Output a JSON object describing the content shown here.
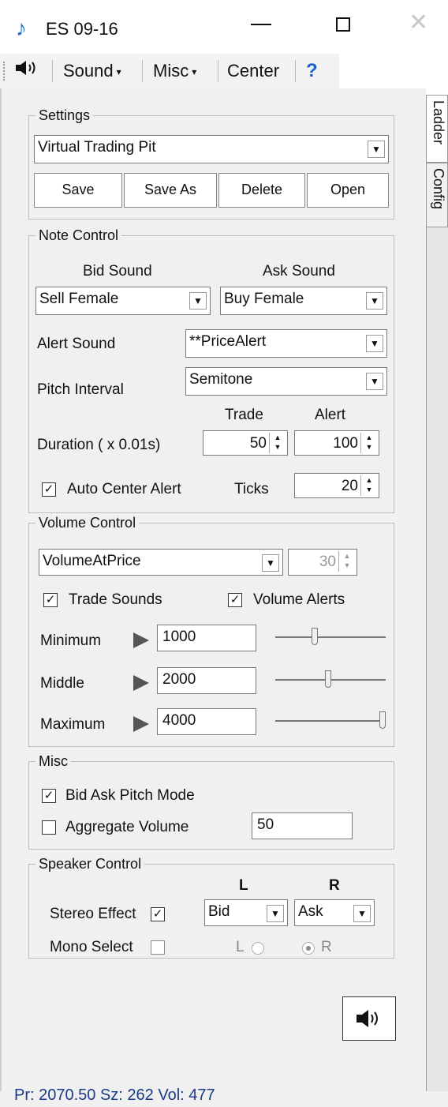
{
  "window": {
    "title": "ES 09-16"
  },
  "toolbar": {
    "sound": "Sound",
    "misc": "Misc",
    "center": "Center",
    "help": "?"
  },
  "tabs": {
    "ladder": "Ladder",
    "config": "Config"
  },
  "settings": {
    "legend": "Settings",
    "profile": "Virtual Trading Pit",
    "save": "Save",
    "save_as": "Save As",
    "delete": "Delete",
    "open": "Open"
  },
  "note_control": {
    "legend": "Note Control",
    "bid_sound_label": "Bid Sound",
    "ask_sound_label": "Ask Sound",
    "bid_sound": "Sell Female",
    "ask_sound": "Buy Female",
    "alert_sound_label": "Alert Sound",
    "alert_sound": "**PriceAlert",
    "pitch_interval_label": "Pitch Interval",
    "pitch_interval": "Semitone",
    "trade_label": "Trade",
    "alert_label": "Alert",
    "duration_label": "Duration ( x 0.01s)",
    "duration_trade": "50",
    "duration_alert": "100",
    "auto_center_label": "Auto Center Alert",
    "auto_center_checked": true,
    "ticks_label": "Ticks",
    "ticks": "20"
  },
  "volume_control": {
    "legend": "Volume Control",
    "mode": "VolumeAtPrice",
    "mode_value": "30",
    "trade_sounds_label": "Trade Sounds",
    "trade_sounds_checked": true,
    "volume_alerts_label": "Volume Alerts",
    "volume_alerts_checked": true,
    "minimum_label": "Minimum",
    "minimum": "1000",
    "minimum_level": 0.35,
    "middle_label": "Middle",
    "middle": "2000",
    "middle_level": 0.48,
    "maximum_label": "Maximum",
    "maximum": "4000",
    "maximum_level": 1.0
  },
  "misc": {
    "legend": "Misc",
    "bid_ask_pitch_label": "Bid Ask Pitch Mode",
    "bid_ask_pitch_checked": true,
    "aggregate_label": "Aggregate Volume",
    "aggregate_checked": false,
    "aggregate_value": "50"
  },
  "speaker_control": {
    "legend": "Speaker Control",
    "l_header": "L",
    "r_header": "R",
    "stereo_label": "Stereo Effect",
    "stereo_checked": true,
    "left_channel": "Bid",
    "right_channel": "Ask",
    "mono_label": "Mono Select",
    "mono_checked": false,
    "radio_l": "L",
    "radio_r": "R",
    "radio_selected": "R"
  },
  "status": {
    "text": "Pr:  2070.50  Sz:  262  Vol:  477"
  }
}
